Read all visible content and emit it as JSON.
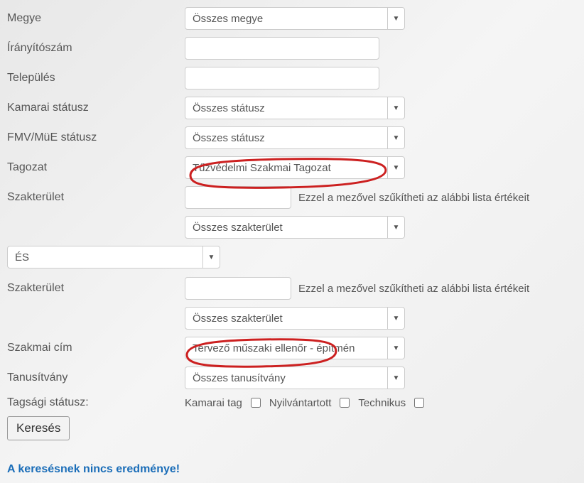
{
  "labels": {
    "megye": "Megye",
    "iranyitoszam": "Írányítószám",
    "telepules": "Település",
    "kamarai_statusz": "Kamarai státusz",
    "fmv_mue_statusz": "FMV/MüE státusz",
    "tagozat": "Tagozat",
    "szakterulet": "Szakterület",
    "szakterulet2": "Szakterület",
    "szakmai_cim": "Szakmai cím",
    "tanusitvany": "Tanusítvány",
    "tagsagi_statusz": "Tagsági státusz:"
  },
  "selects": {
    "megye": "Összes megye",
    "kamarai_statusz": "Összes státusz",
    "fmv_mue_statusz": "Összes státusz",
    "tagozat": "Tűzvédelmi Szakmai Tagozat",
    "szakterulet_list": "Összes szakterület",
    "logic": "ÉS",
    "szakterulet_list2": "Összes szakterület",
    "szakmai_cim": "Tervező műszaki ellenőr - építmén",
    "tanusitvany": "Összes tanusítvány"
  },
  "helper": {
    "szakterulet": "Ezzel a mezővel szűkítheti az alábbi lista értékeit",
    "szakterulet2": "Ezzel a mezővel szűkítheti az alábbi lista értékeit"
  },
  "checkboxes": {
    "kamarai_tag": "Kamarai tag",
    "nyilvantartott": "Nyilvántartott",
    "technikus": "Technikus"
  },
  "buttons": {
    "search": "Keresés"
  },
  "messages": {
    "no_results": "A keresésnek nincs eredménye!"
  }
}
